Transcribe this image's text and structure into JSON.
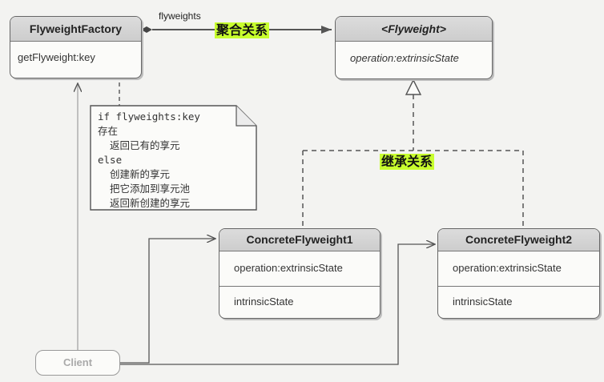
{
  "classes": {
    "factory": {
      "name": "FlyweightFactory",
      "operation": "getFlyweight:key"
    },
    "flyweight": {
      "name": "<Flyweight>",
      "operation": "operation:extrinsicState"
    },
    "concrete1": {
      "name": "ConcreteFlyweight1",
      "operation": "operation:extrinsicState",
      "attribute": "intrinsicState"
    },
    "concrete2": {
      "name": "ConcreteFlyweight2",
      "operation": "operation:extrinsicState",
      "attribute": "intrinsicState"
    },
    "client": {
      "name": "Client"
    }
  },
  "note": {
    "lines": [
      "if flyweights:key",
      "存在",
      "  返回已有的享元",
      "else",
      "  创建新的享元",
      "  把它添加到享元池",
      "  返回新创建的享元"
    ]
  },
  "labels": {
    "association_role": "flyweights",
    "aggregation": "聚合关系",
    "inheritance": "继承关系"
  },
  "colors": {
    "highlight": "#c8ff2e",
    "title_fill": "#d4d4d4",
    "line": "#555555",
    "background": "#f3f3f1"
  }
}
